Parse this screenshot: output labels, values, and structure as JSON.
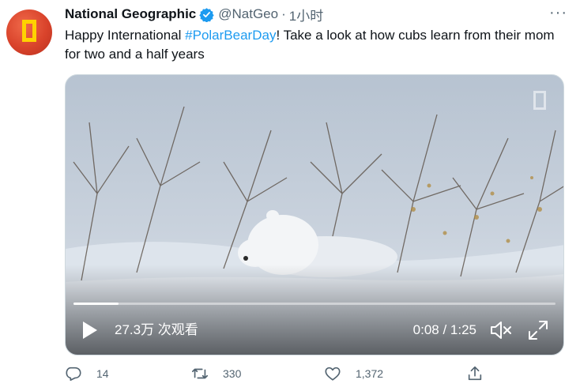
{
  "tweet": {
    "author_name": "National Geographic",
    "handle": "@NatGeo",
    "separator": "·",
    "time": "1小时",
    "more_label": "···",
    "text_prefix": "Happy International ",
    "hashtag": "#PolarBearDay",
    "text_suffix": "! Take a look at how cubs learn from their mom for two and a half years"
  },
  "video": {
    "views": "27.3万 次观看",
    "current_time": "0:08",
    "time_separator": " / ",
    "duration": "1:25",
    "progress_fraction": 0.093
  },
  "actions": {
    "reply_count": "14",
    "retweet_count": "330",
    "like_count": "1,372"
  },
  "colors": {
    "accent": "#1d9bf0",
    "secondary_text": "#536471",
    "brand_yellow": "#ffd200"
  }
}
